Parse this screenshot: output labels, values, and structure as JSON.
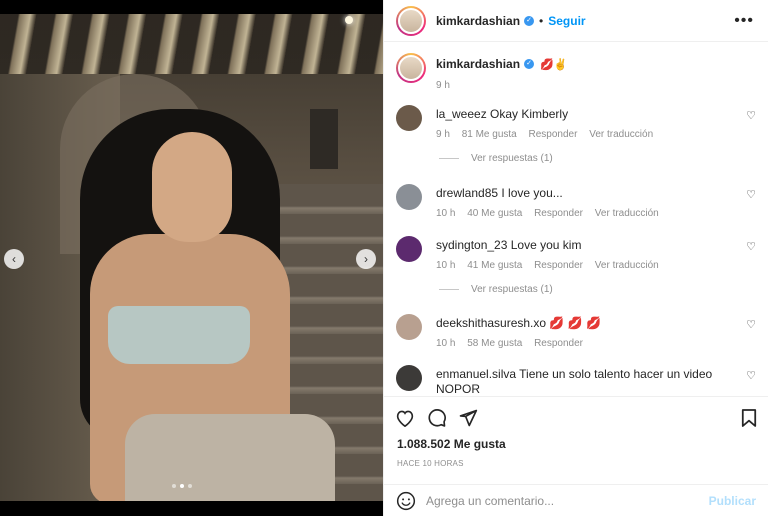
{
  "post": {
    "username": "kimkardashian",
    "follow_label": "Seguir",
    "separator": "•",
    "more_icon": "more-horizontal-icon",
    "caption_emoji": "💋✌",
    "caption_time": "9 h"
  },
  "media": {
    "prev_icon": "chevron-left-icon",
    "next_icon": "chevron-right-icon",
    "carousel_count": 3,
    "carousel_active": 2
  },
  "comments": [
    {
      "user": "la_weeez",
      "text": "Okay Kimberly",
      "time": "9 h",
      "likes": "81 Me gusta",
      "reply": "Responder",
      "translate": "Ver traducción",
      "replies": "Ver respuestas (1)",
      "avatar_color": "#6b5a4a"
    },
    {
      "user": "drewland85",
      "text": "I love you...",
      "time": "10 h",
      "likes": "40 Me gusta",
      "reply": "Responder",
      "translate": "Ver traducción",
      "avatar_color": "#8a8f96"
    },
    {
      "user": "sydington_23",
      "text": "Love you kim",
      "time": "10 h",
      "likes": "41 Me gusta",
      "reply": "Responder",
      "translate": "Ver traducción",
      "replies": "Ver respuestas (1)",
      "avatar_color": "#5c2a6e"
    },
    {
      "user": "deekshithasuresh.xo",
      "text": "💋 💋 💋",
      "time": "10 h",
      "likes": "58 Me gusta",
      "reply": "Responder",
      "avatar_color": "#b8a090"
    },
    {
      "user": "enmanuel.silva",
      "text": "Tiene un solo talento hacer un video NOPOR",
      "avatar_color": "#3c3a38"
    }
  ],
  "actions": {
    "like_icon": "heart-icon",
    "comment_icon": "comment-icon",
    "share_icon": "send-icon",
    "save_icon": "bookmark-icon"
  },
  "likes_count": "1.088.502 Me gusta",
  "date_label": "HACE 10 HORAS",
  "add_comment": {
    "placeholder": "Agrega un comentario...",
    "publish_label": "Publicar",
    "emoji_icon": "smile-icon"
  }
}
